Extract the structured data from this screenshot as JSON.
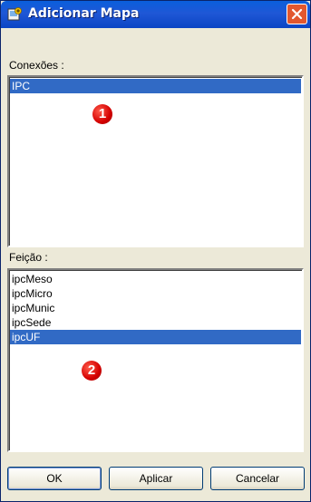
{
  "window": {
    "title": "Adicionar Mapa",
    "icon": "add-map-icon",
    "close_icon": "close-icon"
  },
  "connections": {
    "label": "Conexões :",
    "items": [
      {
        "label": "IPC",
        "selected": true
      }
    ],
    "marker": "1"
  },
  "features": {
    "label": "Feição :",
    "items": [
      {
        "label": "ipcMeso",
        "selected": false
      },
      {
        "label": "ipcMicro",
        "selected": false
      },
      {
        "label": "ipcMunic",
        "selected": false
      },
      {
        "label": "ipcSede",
        "selected": false
      },
      {
        "label": "ipcUF",
        "selected": true
      }
    ],
    "marker": "2"
  },
  "buttons": {
    "ok": "OK",
    "apply": "Aplicar",
    "cancel": "Cancelar"
  },
  "colors": {
    "title_bar": "#0a5fdc",
    "selection": "#316ac5",
    "marker": "#d40000",
    "close": "#e2572f"
  }
}
